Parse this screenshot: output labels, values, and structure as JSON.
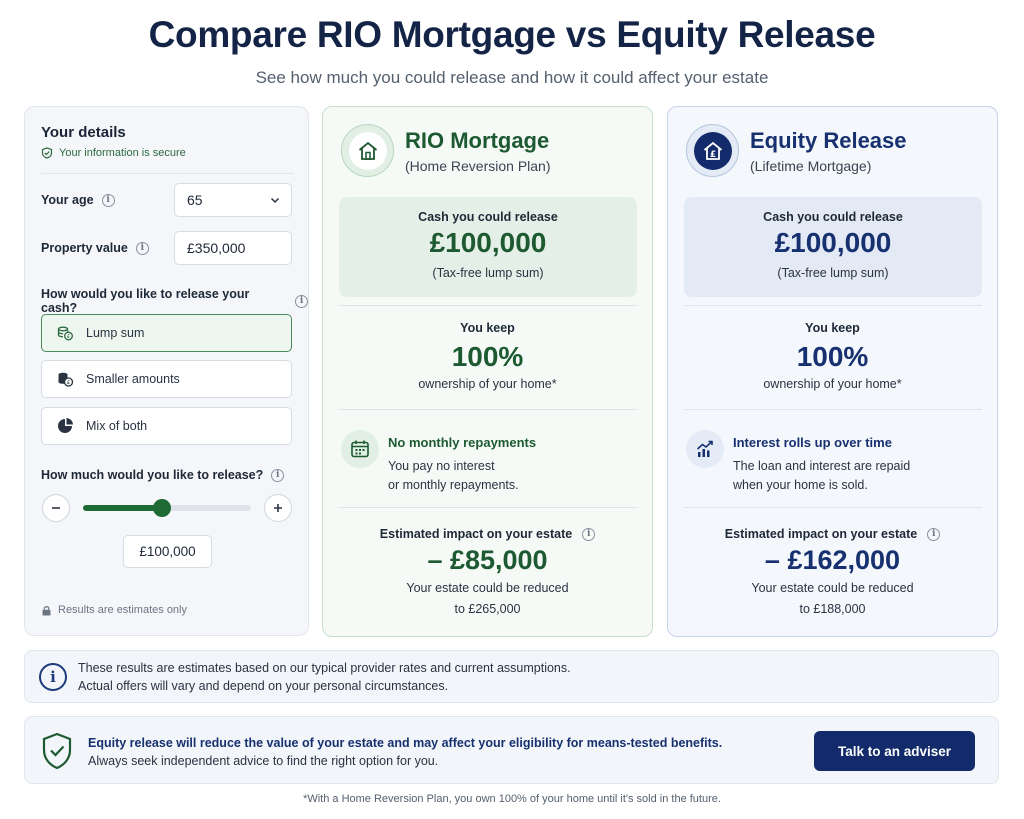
{
  "header": {
    "title": "Compare RIO Mortgage vs Equity Release",
    "subtitle": "See how much you could release and how it could affect your estate"
  },
  "details": {
    "heading": "Your details",
    "secure_text": "Your information is secure",
    "age_label": "Your age",
    "age_value": "65",
    "property_label": "Property value",
    "property_value": "£350,000",
    "release_question": "How would you like to release your cash?",
    "options": [
      {
        "label": "Lump sum",
        "icon": "coins-icon",
        "selected": true
      },
      {
        "label": "Smaller amounts",
        "icon": "coin-stack-icon",
        "selected": false
      },
      {
        "label": "Mix of both",
        "icon": "pie-chart-icon",
        "selected": false
      }
    ],
    "amount_question": "How much would you like to release?",
    "slider_level": 0.47,
    "amount_value": "£100,000",
    "estimates_note": "Results are estimates only"
  },
  "rio": {
    "title": "RIO Mortgage",
    "subtitle": "(Home Reversion Plan)",
    "cash_label": "Cash you could release",
    "cash_value": "£100,000",
    "cash_note": "(Tax-free lump sum)",
    "keep_label": "You keep",
    "keep_value": "100%",
    "keep_note": "ownership of your home*",
    "feature_title": "No monthly repayments",
    "feature_line1": "You pay no interest",
    "feature_line2": "or monthly repayments.",
    "impact_label": "Estimated impact on your estate",
    "impact_value": "– £85,000",
    "impact_note1": "Your estate could be reduced",
    "impact_note2": "to £265,000"
  },
  "equity": {
    "title": "Equity Release",
    "subtitle": "(Lifetime Mortgage)",
    "cash_label": "Cash you could release",
    "cash_value": "£100,000",
    "cash_note": "(Tax-free lump sum)",
    "keep_label": "You keep",
    "keep_value": "100%",
    "keep_note": "ownership of your home*",
    "feature_title": "Interest rolls up over time",
    "feature_line1": "The loan and interest are repaid",
    "feature_line2": "when your home is sold.",
    "impact_label": "Estimated impact on your estate",
    "impact_value": "– £162,000",
    "impact_note1": "Your estate could be reduced",
    "impact_note2": "to £188,000"
  },
  "notice": {
    "line1": "These results are estimates based on our typical provider rates and current assumptions.",
    "line2": "Actual offers will vary and depend on your personal circumstances."
  },
  "warning": {
    "line1": "Equity release will reduce the value of your estate and may affect your eligibility for means-tested benefits.",
    "line2": "Always seek independent advice to find the right option for you.",
    "cta_label": "Talk to an adviser"
  },
  "footnote": "*With a Home Reversion Plan, you own 100% of your home until it's sold in the future.",
  "colors": {
    "rio_accent": "#1d5a31",
    "equity_accent": "#17306f",
    "cta_background": "#132b6b"
  }
}
